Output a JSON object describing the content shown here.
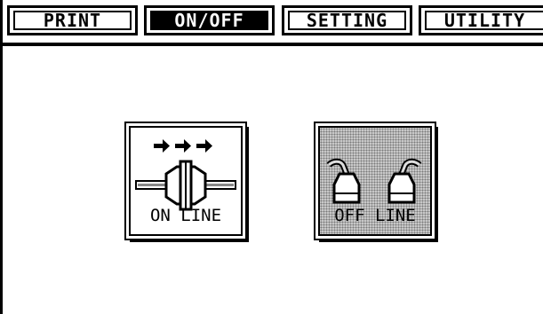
{
  "tabs": [
    {
      "label": "PRINT",
      "active": false
    },
    {
      "label": "ON/OFF",
      "active": true
    },
    {
      "label": "SETTING",
      "active": false
    },
    {
      "label": "UTILITY",
      "active": false
    }
  ],
  "buttons": {
    "online": {
      "label": "ON LINE",
      "icon": "online-connector-icon"
    },
    "offline": {
      "label": "OFF LINE",
      "icon": "offline-connector-icon"
    }
  },
  "colors": {
    "foreground": "#000000",
    "background": "#ffffff",
    "offline_fill": "#c8c8c8"
  }
}
